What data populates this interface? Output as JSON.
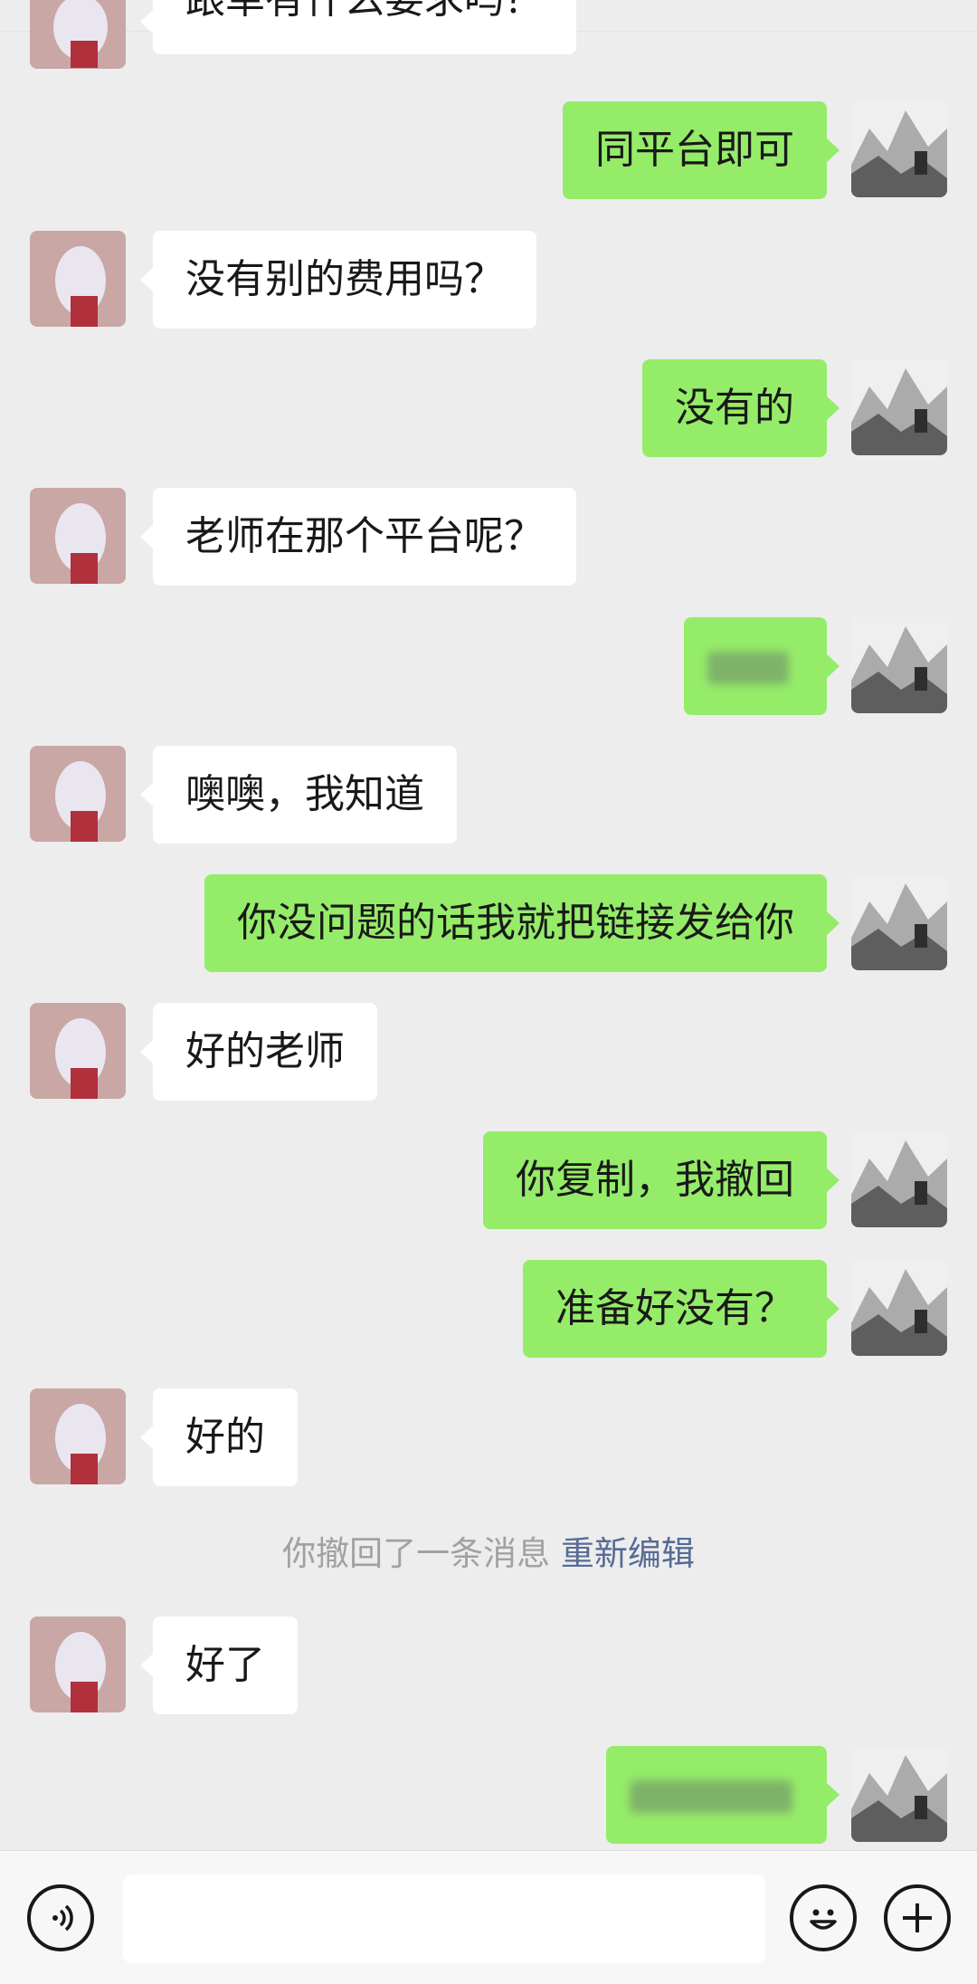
{
  "chat": {
    "partial_top_text": "跟单有什么要求吗？",
    "messages": [
      {
        "side": "right",
        "text": "同平台即可"
      },
      {
        "side": "left",
        "text": "没有别的费用吗？"
      },
      {
        "side": "right",
        "text": "没有的"
      },
      {
        "side": "left",
        "text": "老师在那个平台呢？"
      },
      {
        "side": "right",
        "text": ""
      },
      {
        "side": "left",
        "text": "噢噢，我知道"
      },
      {
        "side": "right",
        "text": "你没问题的话我就把链接发给你"
      },
      {
        "side": "left",
        "text": "好的老师"
      },
      {
        "side": "right",
        "text": "你复制，我撤回"
      },
      {
        "side": "right",
        "text": "准备好没有？"
      },
      {
        "side": "left",
        "text": "好的"
      },
      {
        "side": "left",
        "text": "好了"
      },
      {
        "side": "right",
        "text": ""
      }
    ],
    "system_notice": "你撤回了一条消息",
    "system_notice_action": "重新编辑"
  },
  "input_bar": {
    "voice_icon": "voice-icon",
    "emoji_icon": "emoji-icon",
    "plus_icon": "plus-icon",
    "input_value": ""
  },
  "colors": {
    "background": "#ededed",
    "incoming_bubble": "#ffffff",
    "outgoing_bubble": "#95ec69",
    "link": "#576b95"
  }
}
